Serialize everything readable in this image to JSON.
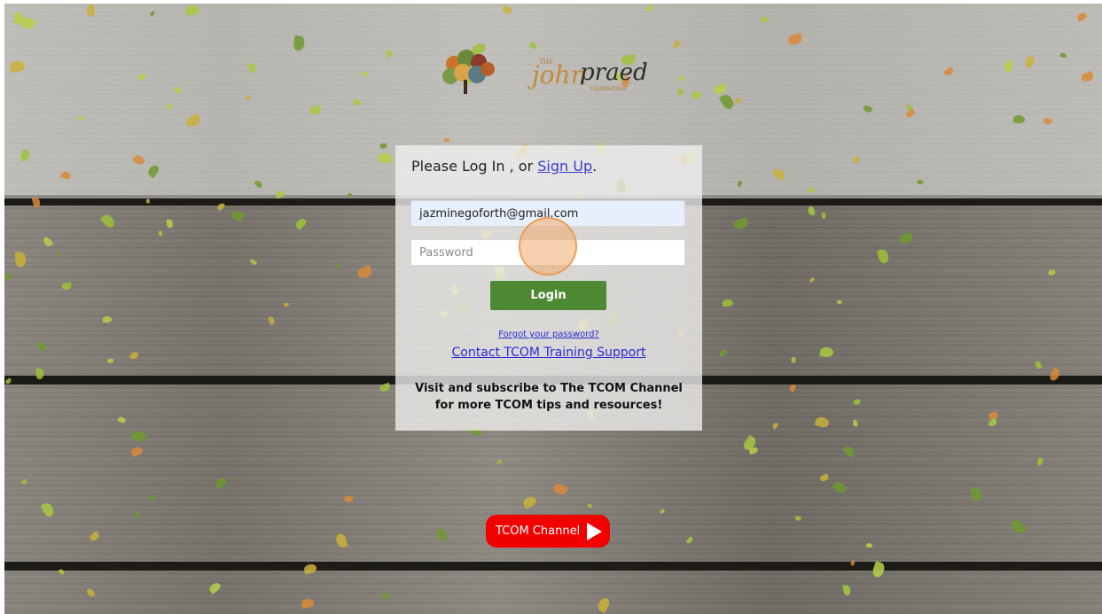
{
  "logo": {
    "small_text": "THE",
    "brand_text": "john praed",
    "sub_text": "FOUNDATION",
    "icon": "tree-logo-icon"
  },
  "login": {
    "prompt_prefix": "Please Log In , or ",
    "signup_link": "Sign Up",
    "prompt_suffix": ".",
    "email_value": "jazminegoforth@gmail.com",
    "password_placeholder": "Password",
    "login_button": "Login",
    "forgot_link": "Forgot your password?",
    "contact_link": "Contact TCOM Training Support",
    "visit_text": "Visit and subscribe to The TCOM Channel for more TCOM tips and resources!"
  },
  "channel_button": {
    "label": "TCOM Channel",
    "icon": "play-icon",
    "color": "#f20000"
  },
  "colors": {
    "accent_green": "#4e8a33",
    "link_blue": "#2a2ad4"
  }
}
